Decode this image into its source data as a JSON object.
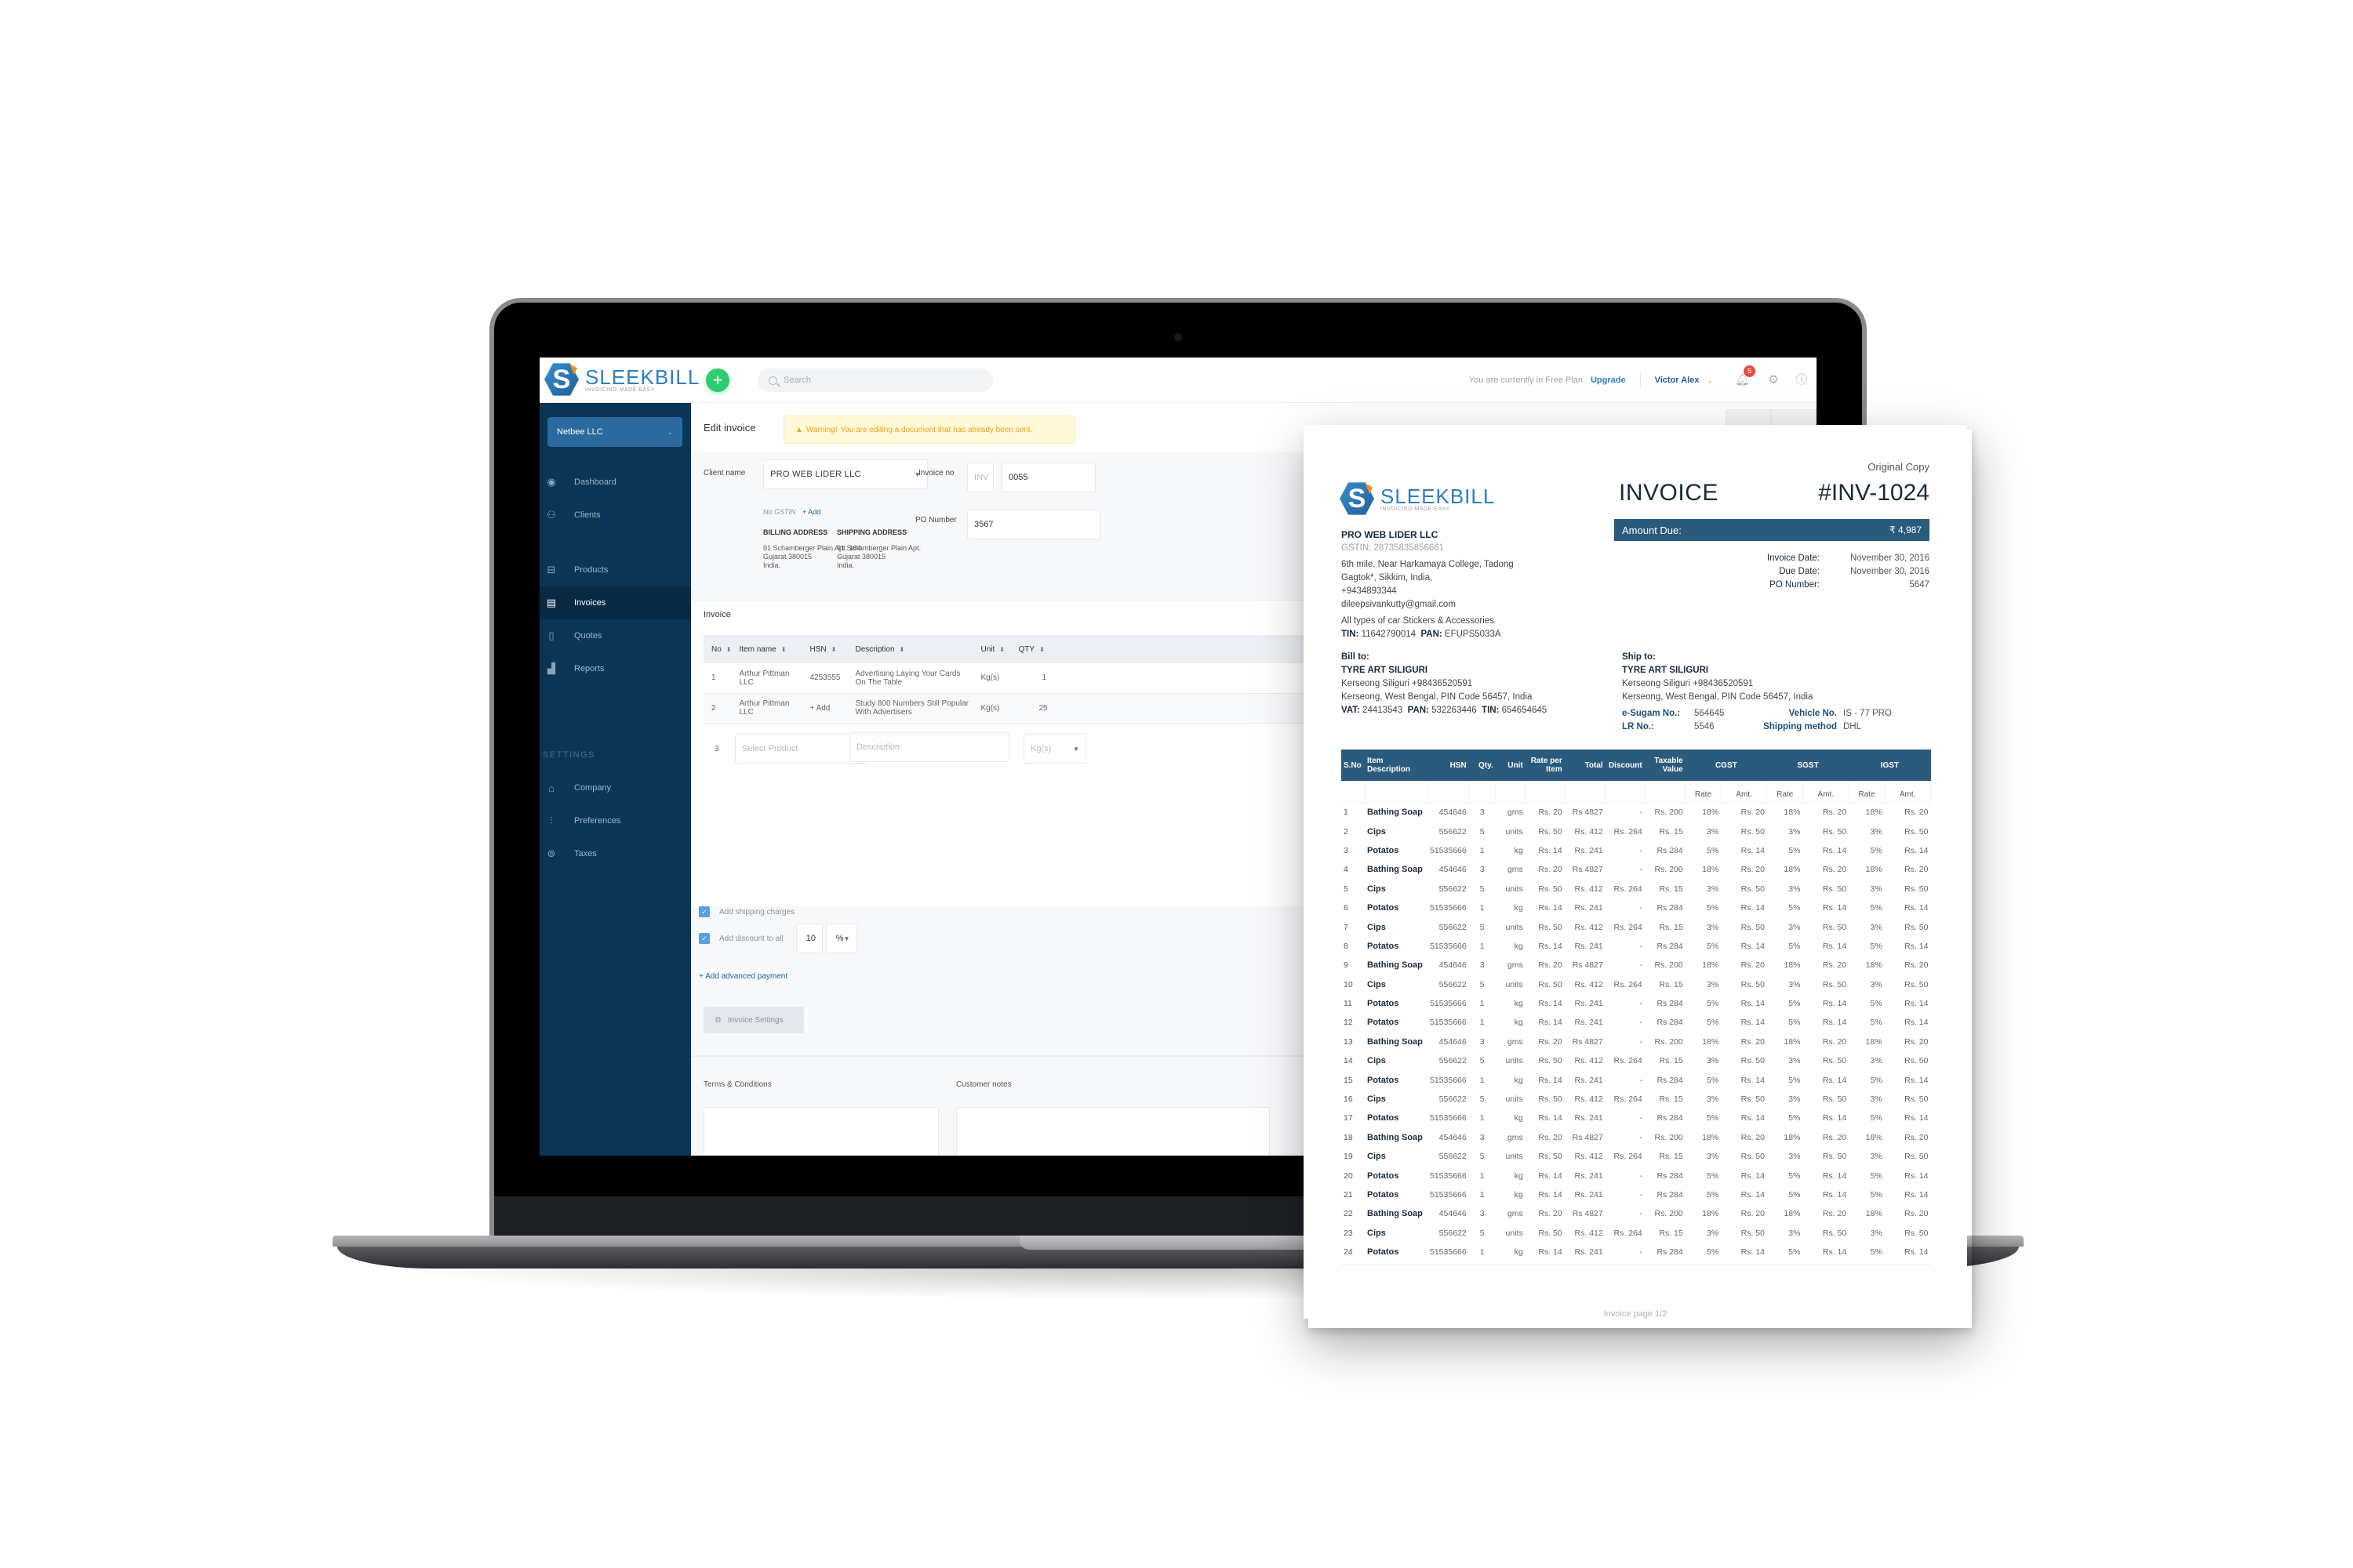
{
  "app": {
    "brand": "SLEEKBILL",
    "tagline": "INVOICING MADE EASY",
    "add_label": "+",
    "search_placeholder": "Search",
    "plan_text": "You are currently in Free Plan",
    "upgrade_label": "Upgrade",
    "user_name": "Victor Alex",
    "notifications_count": "5"
  },
  "sidebar": {
    "org_name": "Netbee LLC",
    "items": [
      {
        "label": "Dashboard",
        "icon": "eye-icon",
        "glyph": "◉"
      },
      {
        "label": "Clients",
        "icon": "users-icon",
        "glyph": "⚇"
      },
      {
        "label": "Products",
        "icon": "basket-icon",
        "glyph": "⊟"
      },
      {
        "label": "Invoices",
        "icon": "invoice-icon",
        "glyph": "▤",
        "active": true
      },
      {
        "label": "Quotes",
        "icon": "quote-icon",
        "glyph": "▯"
      },
      {
        "label": "Reports",
        "icon": "chart-icon",
        "glyph": "▟"
      }
    ],
    "settings_heading": "SETTINGS",
    "settings_items": [
      {
        "label": "Company",
        "icon": "bank-icon",
        "glyph": "⌂"
      },
      {
        "label": "Preferences",
        "icon": "sliders-icon",
        "glyph": "⫶"
      },
      {
        "label": "Taxes",
        "icon": "coins-icon",
        "glyph": "⊚"
      }
    ]
  },
  "editor": {
    "title": "Edit invoice",
    "warning_strong": "Warning!",
    "warning_text": "You are editing a document that has already been sent.",
    "client_label": "Client name",
    "client_value": "PRO WEB LIDER LLC",
    "no_gstin": "No GSTIN",
    "add_label": "+ Add",
    "billing_heading": "BILLING ADDRESS",
    "billing_address": "91 Schamberger Plain Apt. 164\nGujarat 380015\nIndia.",
    "shipping_heading": "SHIPPING ADDRESS",
    "shipping_address": "91 Schamberger Plain Apt.\nGujarat 380015\nIndia.",
    "invoice_no_label": "Invoice no",
    "invoice_prefix": "INV",
    "invoice_number": "0055",
    "po_label": "PO Number",
    "po_value": "3567",
    "section_label": "Invoice",
    "columns": [
      "No",
      "Item name",
      "HSN",
      "Description",
      "Unit",
      "QTY"
    ],
    "rows": [
      {
        "no": "1",
        "item": "Arthur Pittman LLC",
        "hsn": "4253555",
        "description": "Advertising Laying Your Cards On The Table",
        "unit": "Kg(s)",
        "qty": "1"
      },
      {
        "no": "2",
        "item": "Arthur Pittman LLC",
        "hsn": "+ Add",
        "description": "Study 800 Numbers Still Popular With Advertisers",
        "unit": "Kg(s)",
        "qty": "25"
      }
    ],
    "new_row": {
      "no": "3",
      "product_placeholder": "Select Product",
      "description_placeholder": "Description",
      "unit_placeholder": "Kg(s)"
    },
    "shipping_charges_label": "Add shipping charges",
    "discount_label": "Add discount to all",
    "discount_value": "10",
    "discount_type": "%",
    "advanced_payment_label": "+ Add advanced payment",
    "invoice_settings_label": "Invoice Settings",
    "terms_label": "Terms & Conditions",
    "notes_label": "Customer notes"
  },
  "document": {
    "copy_label": "Original Copy",
    "title": "INVOICE",
    "number": "#INV-1024",
    "amount_due_label": "Amount Due:",
    "amount_due_value": "₹ 4,987",
    "meta": [
      {
        "k": "Invoice Date:",
        "v": "November 30, 2016"
      },
      {
        "k": "Due Date:",
        "v": "November 30, 2016"
      },
      {
        "k": "PO Number:",
        "v": "5647"
      }
    ],
    "seller": {
      "name": "PRO WEB LIDER LLC",
      "gstin": "GSTIN: 28735835856661",
      "address1": "6th mile, Near Harkamaya College, Tadong",
      "address2": "Gagtok*, Sikkim, India,",
      "phone": "+9434893344",
      "email": "dileepsivankutty@gmail.com",
      "business": "All types of car Stickers & Accessories",
      "tin_label": "TIN:",
      "tin": "11642790014",
      "pan_label": "PAN:",
      "pan": "EFUPS5033A"
    },
    "bill_to": {
      "heading": "Bill to:",
      "name": "TYRE ART SILIGURI",
      "line1": "Kerseong Siliguri   +98436520591",
      "line2": "Kerseong, West Bengal, PIN Code 56457, India",
      "vat_label": "VAT:",
      "vat": "24413543",
      "pan_label": "PAN:",
      "pan": "532263446",
      "tin_label": "TIN:",
      "tin": "654654645"
    },
    "ship_to": {
      "heading": "Ship to:",
      "name": "TYRE ART SILIGURI",
      "line1": "Kerseong Siliguri   +98436520591",
      "line2": "Kerseong, West Bengal, PIN Code 56457, India",
      "esugam_label": "e-Sugam No.:",
      "esugam": "564645",
      "vehicle_label": "Vehicle No.",
      "vehicle": "IS - 77 PRO",
      "lr_label": "LR No.:",
      "lr": "5546",
      "shipping_label": "Shipping method",
      "shipping": "DHL"
    },
    "table_headers": [
      "S.No",
      "Item Description",
      "HSN",
      "Qty.",
      "Unit",
      "Rate per Item",
      "Total",
      "Discount",
      "Taxable Value",
      "CGST",
      "SGST",
      "IGST"
    ],
    "tax_subheaders": [
      "Rate",
      "Amt.",
      "Rate",
      "Amt.",
      "Rate",
      "Amt."
    ],
    "items": [
      {
        "sn": "1",
        "name": "Bathing Soap",
        "hsn": "454646",
        "qty": "3",
        "unit": "gms",
        "rate": "Rs. 20",
        "total": "Rs 4827",
        "discount": "-",
        "taxable": "Rs. 200",
        "cgst_r": "18%",
        "cgst_a": "Rs. 20",
        "sgst_r": "18%",
        "sgst_a": "Rs. 20",
        "igst_r": "18%",
        "igst_a": "Rs. 20"
      },
      {
        "sn": "2",
        "name": "Cips",
        "hsn": "556622",
        "qty": "5",
        "unit": "units",
        "rate": "Rs. 50",
        "total": "Rs. 412",
        "discount": "Rs. 264",
        "taxable": "Rs. 15",
        "cgst_r": "3%",
        "cgst_a": "Rs. 50",
        "sgst_r": "3%",
        "sgst_a": "Rs. 50",
        "igst_r": "3%",
        "igst_a": "Rs. 50"
      },
      {
        "sn": "3",
        "name": "Potatos",
        "hsn": "51535666",
        "qty": "1",
        "unit": "kg",
        "rate": "Rs. 14",
        "total": "Rs. 241",
        "discount": "-",
        "taxable": "Rs 284",
        "cgst_r": "5%",
        "cgst_a": "Rs. 14",
        "sgst_r": "5%",
        "sgst_a": "Rs. 14",
        "igst_r": "5%",
        "igst_a": "Rs. 14"
      },
      {
        "sn": "4",
        "name": "Bathing Soap",
        "hsn": "454646",
        "qty": "3",
        "unit": "gms",
        "rate": "Rs. 20",
        "total": "Rs 4827",
        "discount": "-",
        "taxable": "Rs. 200",
        "cgst_r": "18%",
        "cgst_a": "Rs. 20",
        "sgst_r": "18%",
        "sgst_a": "Rs. 20",
        "igst_r": "18%",
        "igst_a": "Rs. 20"
      },
      {
        "sn": "5",
        "name": "Cips",
        "hsn": "556622",
        "qty": "5",
        "unit": "units",
        "rate": "Rs. 50",
        "total": "Rs. 412",
        "discount": "Rs. 264",
        "taxable": "Rs. 15",
        "cgst_r": "3%",
        "cgst_a": "Rs. 50",
        "sgst_r": "3%",
        "sgst_a": "Rs. 50",
        "igst_r": "3%",
        "igst_a": "Rs. 50"
      },
      {
        "sn": "6",
        "name": "Potatos",
        "hsn": "51535666",
        "qty": "1",
        "unit": "kg",
        "rate": "Rs. 14",
        "total": "Rs. 241",
        "discount": "-",
        "taxable": "Rs 284",
        "cgst_r": "5%",
        "cgst_a": "Rs. 14",
        "sgst_r": "5%",
        "sgst_a": "Rs. 14",
        "igst_r": "5%",
        "igst_a": "Rs. 14"
      },
      {
        "sn": "7",
        "name": "Cips",
        "hsn": "556622",
        "qty": "5",
        "unit": "units",
        "rate": "Rs. 50",
        "total": "Rs. 412",
        "discount": "Rs. 264",
        "taxable": "Rs. 15",
        "cgst_r": "3%",
        "cgst_a": "Rs. 50",
        "sgst_r": "3%",
        "sgst_a": "Rs. 50",
        "igst_r": "3%",
        "igst_a": "Rs. 50"
      },
      {
        "sn": "8",
        "name": "Potatos",
        "hsn": "51535666",
        "qty": "1",
        "unit": "kg",
        "rate": "Rs. 14",
        "total": "Rs. 241",
        "discount": "-",
        "taxable": "Rs 284",
        "cgst_r": "5%",
        "cgst_a": "Rs. 14",
        "sgst_r": "5%",
        "sgst_a": "Rs. 14",
        "igst_r": "5%",
        "igst_a": "Rs. 14"
      },
      {
        "sn": "9",
        "name": "Bathing Soap",
        "hsn": "454646",
        "qty": "3",
        "unit": "gms",
        "rate": "Rs. 20",
        "total": "Rs 4827",
        "discount": "-",
        "taxable": "Rs. 200",
        "cgst_r": "18%",
        "cgst_a": "Rs. 20",
        "sgst_r": "18%",
        "sgst_a": "Rs. 20",
        "igst_r": "18%",
        "igst_a": "Rs. 20"
      },
      {
        "sn": "10",
        "name": "Cips",
        "hsn": "556622",
        "qty": "5",
        "unit": "units",
        "rate": "Rs. 50",
        "total": "Rs. 412",
        "discount": "Rs. 264",
        "taxable": "Rs. 15",
        "cgst_r": "3%",
        "cgst_a": "Rs. 50",
        "sgst_r": "3%",
        "sgst_a": "Rs. 50",
        "igst_r": "3%",
        "igst_a": "Rs. 50"
      },
      {
        "sn": "11",
        "name": "Potatos",
        "hsn": "51535666",
        "qty": "1",
        "unit": "kg",
        "rate": "Rs. 14",
        "total": "Rs. 241",
        "discount": "-",
        "taxable": "Rs 284",
        "cgst_r": "5%",
        "cgst_a": "Rs. 14",
        "sgst_r": "5%",
        "sgst_a": "Rs. 14",
        "igst_r": "5%",
        "igst_a": "Rs. 14"
      },
      {
        "sn": "12",
        "name": "Potatos",
        "hsn": "51535666",
        "qty": "1",
        "unit": "kg",
        "rate": "Rs. 14",
        "total": "Rs. 241",
        "discount": "-",
        "taxable": "Rs 284",
        "cgst_r": "5%",
        "cgst_a": "Rs. 14",
        "sgst_r": "5%",
        "sgst_a": "Rs. 14",
        "igst_r": "5%",
        "igst_a": "Rs. 14"
      },
      {
        "sn": "13",
        "name": "Bathing Soap",
        "hsn": "454646",
        "qty": "3",
        "unit": "gms",
        "rate": "Rs. 20",
        "total": "Rs 4827",
        "discount": "-",
        "taxable": "Rs. 200",
        "cgst_r": "18%",
        "cgst_a": "Rs. 20",
        "sgst_r": "18%",
        "sgst_a": "Rs. 20",
        "igst_r": "18%",
        "igst_a": "Rs. 20"
      },
      {
        "sn": "14",
        "name": "Cips",
        "hsn": "556622",
        "qty": "5",
        "unit": "units",
        "rate": "Rs. 50",
        "total": "Rs. 412",
        "discount": "Rs. 264",
        "taxable": "Rs. 15",
        "cgst_r": "3%",
        "cgst_a": "Rs. 50",
        "sgst_r": "3%",
        "sgst_a": "Rs. 50",
        "igst_r": "3%",
        "igst_a": "Rs. 50"
      },
      {
        "sn": "15",
        "name": "Potatos",
        "hsn": "51535666",
        "qty": "1",
        "unit": "kg",
        "rate": "Rs. 14",
        "total": "Rs. 241",
        "discount": "-",
        "taxable": "Rs 284",
        "cgst_r": "5%",
        "cgst_a": "Rs. 14",
        "sgst_r": "5%",
        "sgst_a": "Rs. 14",
        "igst_r": "5%",
        "igst_a": "Rs. 14"
      },
      {
        "sn": "16",
        "name": "Cips",
        "hsn": "556622",
        "qty": "5",
        "unit": "units",
        "rate": "Rs. 50",
        "total": "Rs. 412",
        "discount": "Rs. 264",
        "taxable": "Rs. 15",
        "cgst_r": "3%",
        "cgst_a": "Rs. 50",
        "sgst_r": "3%",
        "sgst_a": "Rs. 50",
        "igst_r": "3%",
        "igst_a": "Rs. 50"
      },
      {
        "sn": "17",
        "name": "Potatos",
        "hsn": "51535666",
        "qty": "1",
        "unit": "kg",
        "rate": "Rs. 14",
        "total": "Rs. 241",
        "discount": "-",
        "taxable": "Rs 284",
        "cgst_r": "5%",
        "cgst_a": "Rs. 14",
        "sgst_r": "5%",
        "sgst_a": "Rs. 14",
        "igst_r": "5%",
        "igst_a": "Rs. 14"
      },
      {
        "sn": "18",
        "name": "Bathing Soap",
        "hsn": "454646",
        "qty": "3",
        "unit": "gms",
        "rate": "Rs. 20",
        "total": "Rs 4827",
        "discount": "-",
        "taxable": "Rs. 200",
        "cgst_r": "18%",
        "cgst_a": "Rs. 20",
        "sgst_r": "18%",
        "sgst_a": "Rs. 20",
        "igst_r": "18%",
        "igst_a": "Rs. 20"
      },
      {
        "sn": "19",
        "name": "Cips",
        "hsn": "556622",
        "qty": "5",
        "unit": "units",
        "rate": "Rs. 50",
        "total": "Rs. 412",
        "discount": "Rs. 264",
        "taxable": "Rs. 15",
        "cgst_r": "3%",
        "cgst_a": "Rs. 50",
        "sgst_r": "3%",
        "sgst_a": "Rs. 50",
        "igst_r": "3%",
        "igst_a": "Rs. 50"
      },
      {
        "sn": "20",
        "name": "Potatos",
        "hsn": "51535666",
        "qty": "1",
        "unit": "kg",
        "rate": "Rs. 14",
        "total": "Rs. 241",
        "discount": "-",
        "taxable": "Rs 284",
        "cgst_r": "5%",
        "cgst_a": "Rs. 14",
        "sgst_r": "5%",
        "sgst_a": "Rs. 14",
        "igst_r": "5%",
        "igst_a": "Rs. 14"
      },
      {
        "sn": "21",
        "name": "Potatos",
        "hsn": "51535666",
        "qty": "1",
        "unit": "kg",
        "rate": "Rs. 14",
        "total": "Rs. 241",
        "discount": "-",
        "taxable": "Rs 284",
        "cgst_r": "5%",
        "cgst_a": "Rs. 14",
        "sgst_r": "5%",
        "sgst_a": "Rs. 14",
        "igst_r": "5%",
        "igst_a": "Rs. 14"
      },
      {
        "sn": "22",
        "name": "Bathing Soap",
        "hsn": "454646",
        "qty": "3",
        "unit": "gms",
        "rate": "Rs. 20",
        "total": "Rs 4827",
        "discount": "-",
        "taxable": "Rs. 200",
        "cgst_r": "18%",
        "cgst_a": "Rs. 20",
        "sgst_r": "18%",
        "sgst_a": "Rs. 20",
        "igst_r": "18%",
        "igst_a": "Rs. 20"
      },
      {
        "sn": "23",
        "name": "Cips",
        "hsn": "556622",
        "qty": "5",
        "unit": "units",
        "rate": "Rs. 50",
        "total": "Rs. 412",
        "discount": "Rs. 264",
        "taxable": "Rs. 15",
        "cgst_r": "3%",
        "cgst_a": "Rs. 50",
        "sgst_r": "3%",
        "sgst_a": "Rs. 50",
        "igst_r": "3%",
        "igst_a": "Rs. 50"
      },
      {
        "sn": "24",
        "name": "Potatos",
        "hsn": "51535666",
        "qty": "1",
        "unit": "kg",
        "rate": "Rs. 14",
        "total": "Rs. 241",
        "discount": "-",
        "taxable": "Rs 284",
        "cgst_r": "5%",
        "cgst_a": "Rs. 14",
        "sgst_r": "5%",
        "sgst_a": "Rs. 14",
        "igst_r": "5%",
        "igst_a": "Rs. 14"
      }
    ],
    "page_footer": "Invoice page 1/2"
  },
  "colors": {
    "sidebar_bg": "#0a3556",
    "brand_blue": "#2b7fc0",
    "add_green": "#2ecc71",
    "table_header": "#2a5b7c",
    "warning_text": "#e8a317",
    "badge_red": "#e74c3c"
  }
}
